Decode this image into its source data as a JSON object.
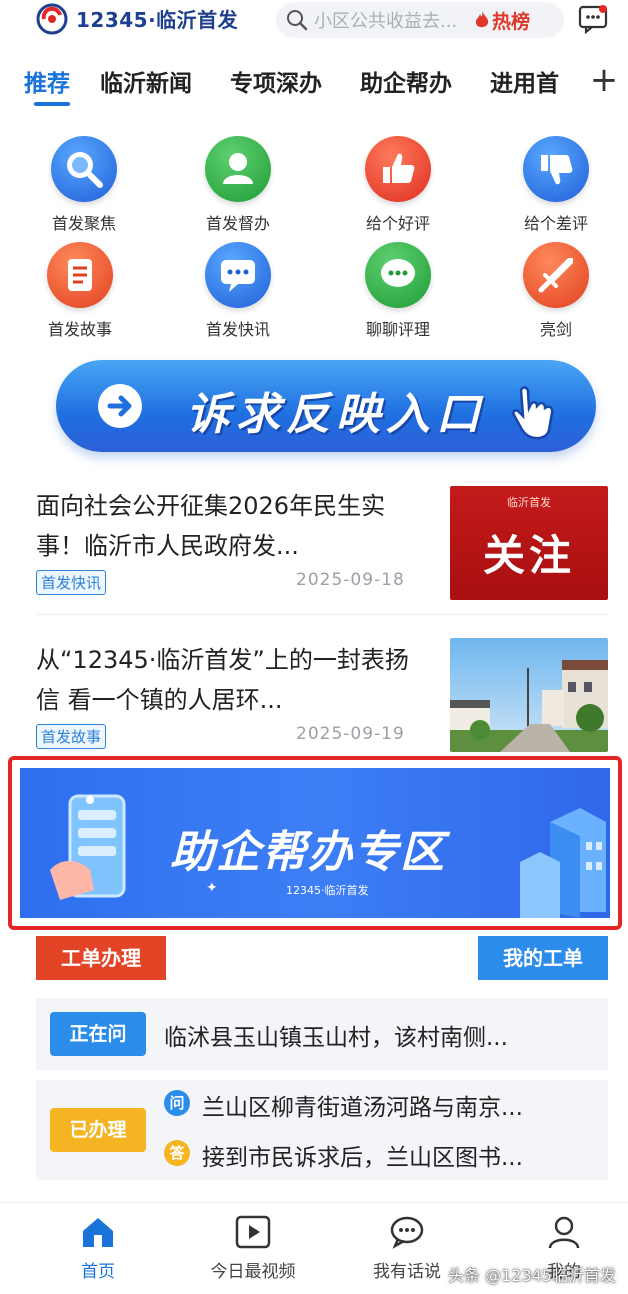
{
  "header": {
    "logo_text": "12345·临沂首发",
    "search_placeholder": "小区公共收益去...",
    "hot_label": "热榜"
  },
  "tabs": [
    {
      "label": "推荐",
      "active": true
    },
    {
      "label": "临沂新闻"
    },
    {
      "label": "专项深办"
    },
    {
      "label": "助企帮办"
    },
    {
      "label": "进用首"
    }
  ],
  "tab_more": "+",
  "grid": [
    {
      "label": "首发聚焦",
      "icon": "magnifier-icon",
      "color": "#1f6fe0"
    },
    {
      "label": "首发督办",
      "icon": "person-icon",
      "color": "#27a53e"
    },
    {
      "label": "给个好评",
      "icon": "thumbs-up-icon",
      "color": "#e23b2b"
    },
    {
      "label": "给个差评",
      "icon": "thumbs-down-icon",
      "color": "#1f6fe0"
    },
    {
      "label": "首发故事",
      "icon": "document-icon",
      "color": "#e8462a"
    },
    {
      "label": "首发快讯",
      "icon": "chat-bubble-icon",
      "color": "#1f6fe0"
    },
    {
      "label": "聊聊评理",
      "icon": "chat-dots-icon",
      "color": "#27a53e"
    },
    {
      "label": "亮剑",
      "icon": "sword-icon",
      "color": "#e8462a"
    }
  ],
  "entry_banner": {
    "label": "诉求反映入口"
  },
  "news": [
    {
      "title": "面向社会公开征集2026年民生实事！临沂市人民政府发...",
      "tag": "首发快讯",
      "date": "2025-09-18",
      "image_text": "关注",
      "image_brand": "临沂首发"
    },
    {
      "title": "从“12345·临沂首发”上的一封表扬信 看一个镇的人居环...",
      "tag": "首发故事",
      "date": "2025-09-19"
    }
  ],
  "zone_banner": {
    "title": "助企帮办专区",
    "subtitle": "12345·临沂首发"
  },
  "work_order": {
    "left_label": "工单办理",
    "right_label": "我的工单",
    "asking": {
      "badge": "正在问",
      "text": "临沭县玉山镇玉山村，该村南侧..."
    },
    "done": {
      "badge": "已办理",
      "q_icon": "问",
      "q_text": "兰山区柳青街道汤河路与南京...",
      "a_icon": "答",
      "a_text": "接到市民诉求后，兰山区图书..."
    }
  },
  "bottom_nav": [
    {
      "label": "首页",
      "icon": "home-icon",
      "active": true
    },
    {
      "label": "今日最视频",
      "icon": "play-icon"
    },
    {
      "label": "我有话说",
      "icon": "speech-icon"
    },
    {
      "label": "我的",
      "icon": "user-icon"
    }
  ],
  "watermark": "头条 @12345临沂首发",
  "colors": {
    "accent": "#1a73d9",
    "red": "#e32727"
  }
}
